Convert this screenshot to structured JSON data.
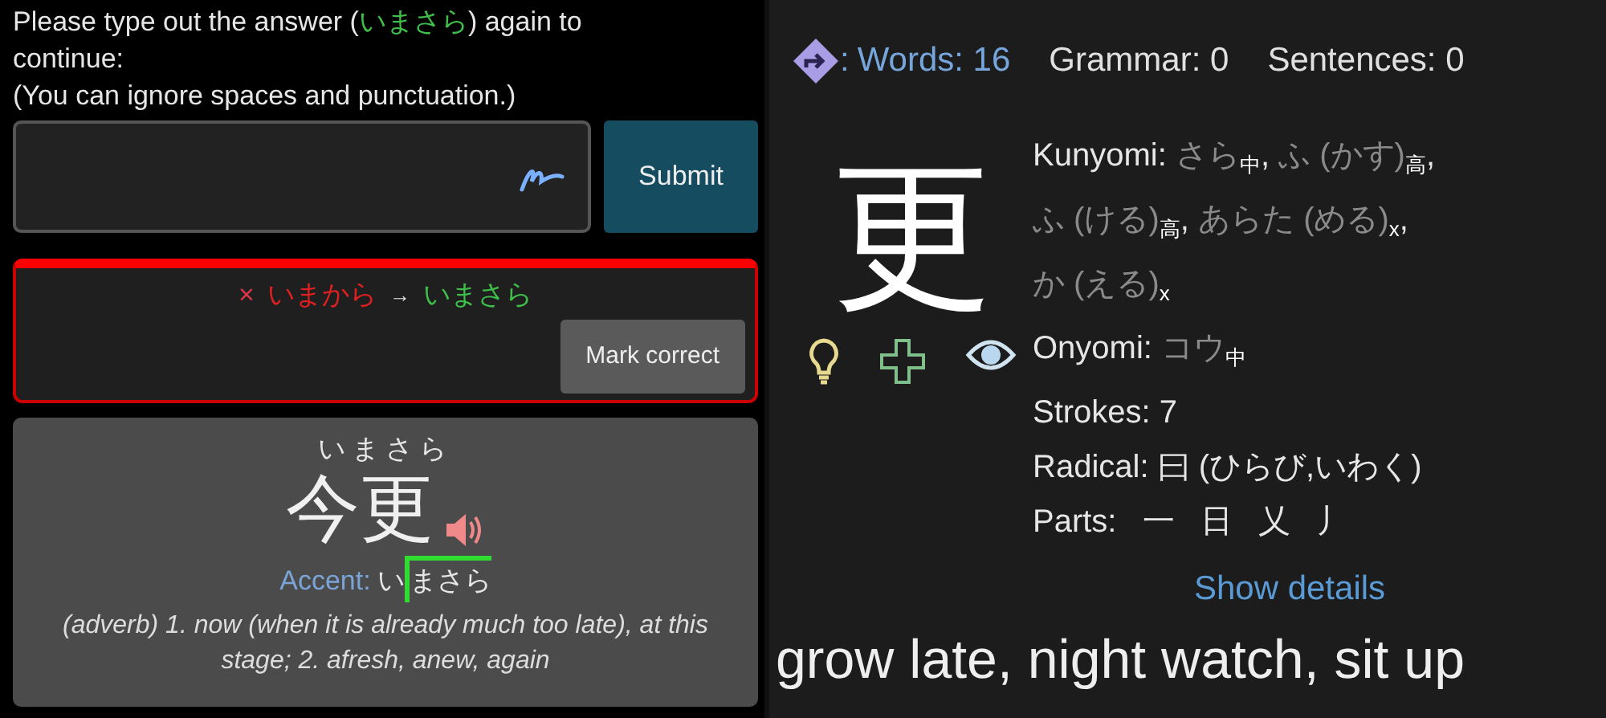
{
  "prompt": {
    "before": "Please type out the answer (",
    "answer": "いまさら",
    "after": ") again to continue:"
  },
  "hint": "(You can ignore spaces and punctuation.)",
  "submit": "Submit",
  "result": {
    "wrong_mark": "×",
    "wrong": "いまから",
    "arrow": "→",
    "right": "いまさら",
    "button": "Mark correct"
  },
  "vocab": {
    "furigana": "いまさら",
    "word": "今更",
    "accent_label": "Accent:",
    "accent": [
      {
        "text": "い",
        "high": false
      },
      {
        "text": "ま",
        "high": true
      },
      {
        "text": "さ",
        "high": true
      },
      {
        "text": "ら",
        "high": true
      }
    ],
    "definition": "(adverb) 1. now (when it is already much too late), at this stage; 2. afresh, anew, again"
  },
  "stats_colon": ":",
  "stats": [
    {
      "text": "Words: 16",
      "kind": "link"
    },
    {
      "text": "Grammar: 0",
      "kind": "plain"
    },
    {
      "text": "Sentences: 0",
      "kind": "plain"
    }
  ],
  "kanji": {
    "char": "更",
    "kunyomi": {
      "label": "Kunyomi:",
      "readings": [
        {
          "reading": "さら",
          "grade": "中",
          "separator": ","
        },
        {
          "reading": "ふ (かす)",
          "grade": "高",
          "separator": ","
        },
        {
          "reading": "ふ (ける)",
          "grade": "高",
          "separator": ","
        },
        {
          "reading": "あらた (める)",
          "grade": "x",
          "separator": ","
        },
        {
          "reading": "か (える)",
          "grade": "x"
        }
      ]
    },
    "onyomi": {
      "label": "Onyomi:",
      "readings": [
        {
          "reading": "コウ",
          "grade": "中"
        }
      ]
    },
    "info": [
      {
        "label": "Strokes:",
        "value": "7"
      },
      {
        "label": "Radical:",
        "value": "⽈ (ひらび,いわく)"
      }
    ],
    "parts_label": "Parts:",
    "parts": [
      "一",
      "日",
      "乂",
      "丿"
    ],
    "details": "Show details"
  },
  "meaning": "grow late, night watch, sit up"
}
